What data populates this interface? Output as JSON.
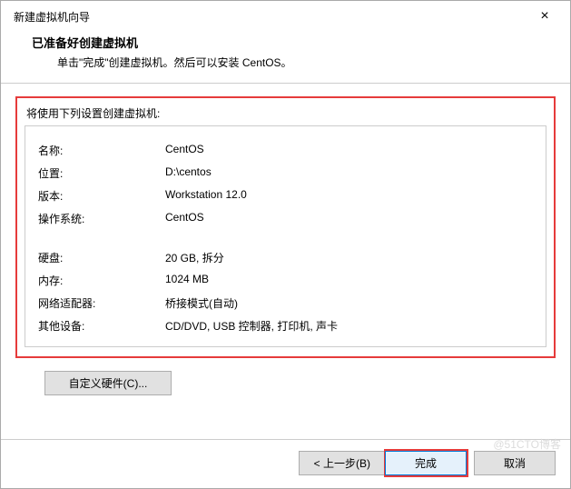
{
  "window": {
    "title": "新建虚拟机向导",
    "close_icon": "×"
  },
  "header": {
    "title": "已准备好创建虚拟机",
    "subtitle": "单击\"完成\"创建虚拟机。然后可以安装 CentOS。"
  },
  "settings": {
    "group_label": "将使用下列设置创建虚拟机:",
    "rows": [
      {
        "label": "名称:",
        "value": "CentOS"
      },
      {
        "label": "位置:",
        "value": "D:\\centos"
      },
      {
        "label": "版本:",
        "value": "Workstation 12.0"
      },
      {
        "label": "操作系统:",
        "value": "CentOS"
      }
    ],
    "rows2": [
      {
        "label": "硬盘:",
        "value": "20 GB, 拆分"
      },
      {
        "label": "内存:",
        "value": "1024 MB"
      },
      {
        "label": "网络适配器:",
        "value": "桥接模式(自动)"
      },
      {
        "label": "其他设备:",
        "value": "CD/DVD, USB 控制器, 打印机, 声卡"
      }
    ]
  },
  "buttons": {
    "customize": "自定义硬件(C)...",
    "back": "< 上一步(B)",
    "finish": "完成",
    "cancel": "取消"
  },
  "watermark": "@51CTO博客"
}
